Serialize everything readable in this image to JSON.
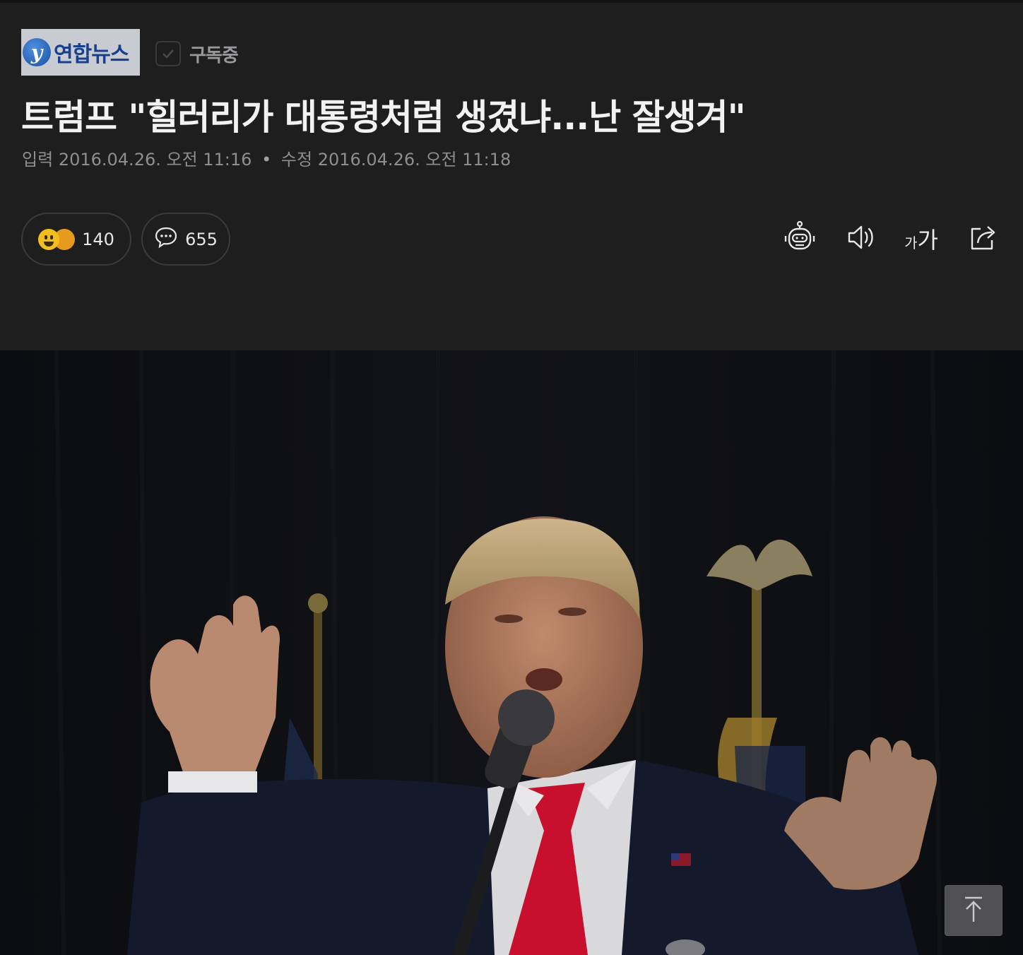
{
  "press": {
    "name": "연합뉴스",
    "mark": "y"
  },
  "subscribe": {
    "label": "구독중"
  },
  "article": {
    "title": "트럼프 \"힐러리가 대통령처럼 생겼냐...난 잘생겨\"",
    "input_label": "입력",
    "input_date": "2016.04.26. 오전 11:16",
    "separator": "•",
    "edit_label": "수정",
    "edit_date": "2016.04.26. 오전 11:18"
  },
  "reactions": {
    "count": "140"
  },
  "comments": {
    "count": "655"
  },
  "toolbar": {
    "robot_icon": "summary-bot-icon",
    "speaker_icon": "speaker-icon",
    "font_small": "가",
    "font_large": "가",
    "share_icon": "share-icon"
  },
  "photo": {
    "subject": "speaker-at-microphone"
  },
  "colors": {
    "background": "#1e1e1f",
    "tie_red": "#c8102e",
    "text_primary": "#f2f2f2",
    "text_secondary": "#8e8e90"
  }
}
